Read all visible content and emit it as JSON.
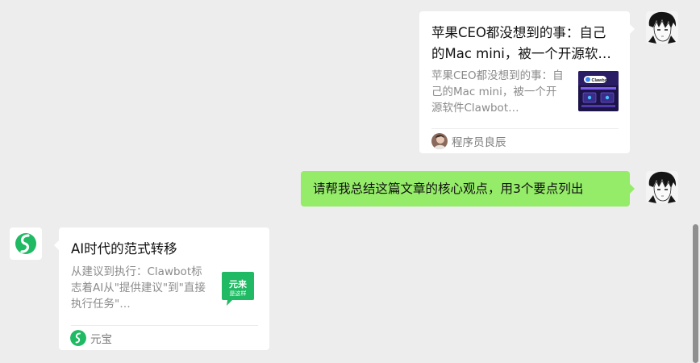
{
  "messages": [
    {
      "side": "right",
      "type": "article-card",
      "title": "苹果CEO都没想到的事：自己的Mac mini，被一个开源软件Clawbot…",
      "description": "苹果CEO都没想到的事：自己的Mac mini，被一个开源软件Clawbot…",
      "thumbnail_text": "Clawbot",
      "source": "程序员良辰"
    },
    {
      "side": "right",
      "type": "text",
      "text": "请帮我总结这篇文章的核心观点，用3个要点列出"
    },
    {
      "side": "left",
      "type": "article-card",
      "title": "AI时代的范式转移",
      "description": "从建议到执行：Clawbot标志着AI从\"提供建议\"到\"直接执行任务\"…",
      "thumbnail_text": "元来是这样",
      "source": "元宝"
    }
  ],
  "colors": {
    "background": "#ededed",
    "my_bubble": "#95ec69",
    "card": "#ffffff",
    "yuanbao_green": "#1fba63"
  },
  "icons": {
    "my_avatar": "manga-avatar-icon",
    "bot_avatar": "yuanbao-logo-icon",
    "source_avatar": "author-avatar-icon"
  }
}
